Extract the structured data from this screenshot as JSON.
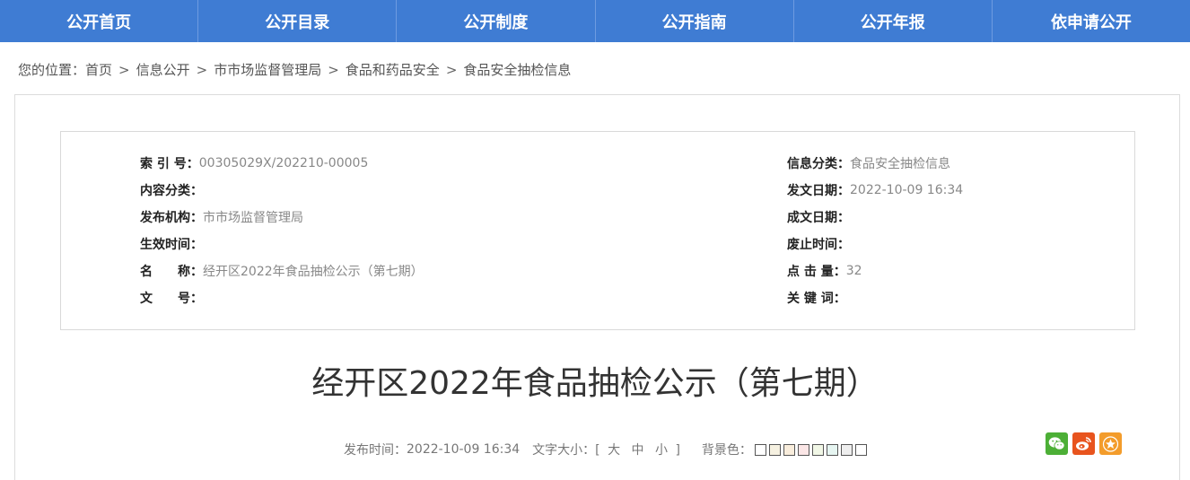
{
  "nav": {
    "items": [
      "公开首页",
      "公开目录",
      "公开制度",
      "公开指南",
      "公开年报",
      "依申请公开"
    ]
  },
  "breadcrumb": {
    "prefix": "您的位置：",
    "separator": ">",
    "items": [
      "首页",
      "信息公开",
      "市市场监督管理局",
      "食品和药品安全",
      "食品安全抽检信息"
    ]
  },
  "meta": {
    "left": [
      {
        "key": "索 引 号：",
        "value": "00305029X/202210-00005"
      },
      {
        "key": "内容分类：",
        "value": ""
      },
      {
        "key": "发布机构：",
        "value": "市市场监督管理局"
      },
      {
        "key": "生效时间：",
        "value": ""
      },
      {
        "key": "名　　称：",
        "value": "经开区2022年食品抽检公示（第七期）"
      },
      {
        "key": "文　　号：",
        "value": ""
      }
    ],
    "right": [
      {
        "key": "信息分类：",
        "value": "食品安全抽检信息"
      },
      {
        "key": "发文日期：",
        "value": "2022-10-09 16:34"
      },
      {
        "key": "成文日期：",
        "value": ""
      },
      {
        "key": "废止时间：",
        "value": ""
      },
      {
        "key": "点 击 量：",
        "value": "32"
      },
      {
        "key": "关 键 词：",
        "value": ""
      }
    ]
  },
  "article": {
    "title": "经开区2022年食品抽检公示（第七期）",
    "publish_label": "发布时间：",
    "publish_time": "2022-10-09 16:34",
    "font_size_label": "文字大小：[",
    "font_size_close": "]",
    "sizes": [
      "大",
      "中",
      "小"
    ],
    "bg_label": "背景色：",
    "bg_colors": [
      "#ffffff",
      "#f6f1e1",
      "#f9eddc",
      "#fbe6e6",
      "#f1f7e6",
      "#e6f5f1",
      "#eeeeee",
      "#ffffff"
    ]
  },
  "share": {
    "icons": [
      {
        "name": "wechat-icon",
        "color": "#4caf36"
      },
      {
        "name": "weibo-icon",
        "color": "#e8541e"
      },
      {
        "name": "favorite-icon",
        "color": "#f39c2b"
      }
    ]
  }
}
